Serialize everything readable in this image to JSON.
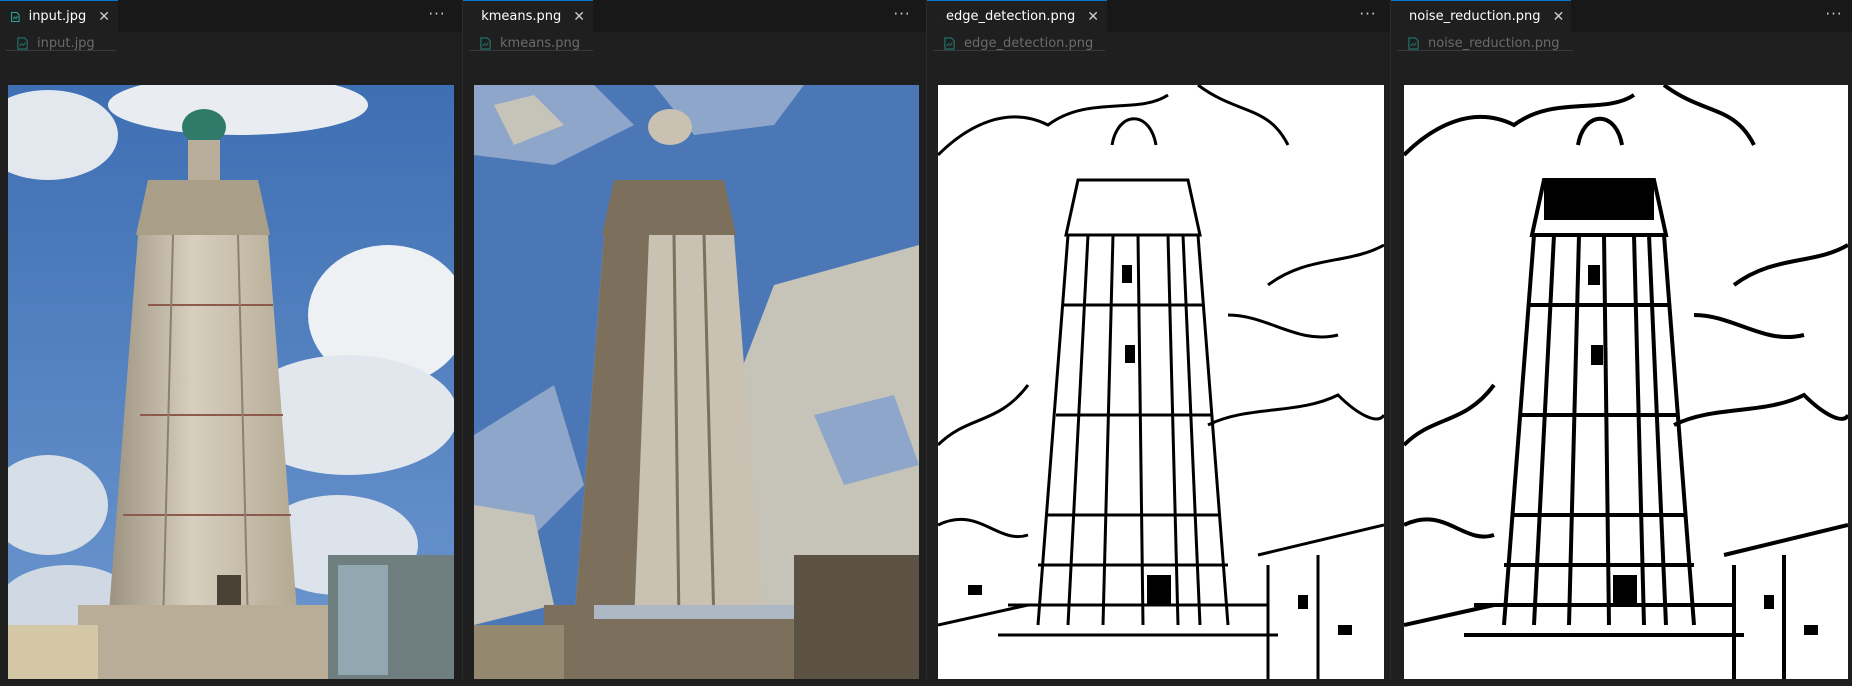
{
  "groups": [
    {
      "tab": {
        "label": "input.jpg",
        "icon": "image-file-icon",
        "close_symbol": "✕"
      },
      "more_symbol": "···",
      "breadcrumb": {
        "label": "input.jpg",
        "icon": "image-file-icon"
      },
      "image": {
        "name": "input-photo",
        "style": "photo"
      }
    },
    {
      "tab": {
        "label": "kmeans.png",
        "icon": "image-file-icon",
        "close_symbol": "✕"
      },
      "more_symbol": "···",
      "breadcrumb": {
        "label": "kmeans.png",
        "icon": "image-file-icon"
      },
      "image": {
        "name": "kmeans-photo",
        "style": "posterized"
      }
    },
    {
      "tab": {
        "label": "edge_detection.png",
        "icon": "image-file-icon",
        "close_symbol": "✕"
      },
      "more_symbol": "···",
      "breadcrumb": {
        "label": "edge_detection.png",
        "icon": "image-file-icon"
      },
      "image": {
        "name": "edge-detection-photo",
        "style": "edges"
      }
    },
    {
      "tab": {
        "label": "noise_reduction.png",
        "icon": "image-file-icon",
        "close_symbol": "✕"
      },
      "more_symbol": "···",
      "breadcrumb": {
        "label": "noise_reduction.png",
        "icon": "image-file-icon"
      },
      "image": {
        "name": "noise-reduction-photo",
        "style": "edges-bold"
      }
    }
  ],
  "colors": {
    "background": "#1f1f1f",
    "tab_active_border": "#0078d4",
    "icon_teal": "#26a69a",
    "sky": "#4f7fbf",
    "cloud": "#e6eaf0",
    "tower": "#c8bfae",
    "tower_shadow": "#7d7260"
  }
}
